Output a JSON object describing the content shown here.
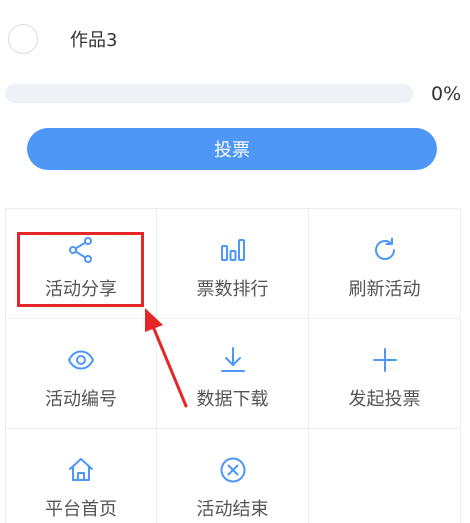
{
  "option": {
    "label": "作品3"
  },
  "progress": {
    "percent": 0,
    "text": "0%"
  },
  "vote_button": {
    "label": "投票"
  },
  "menu": {
    "items": [
      {
        "label": "活动分享",
        "icon": "share-icon"
      },
      {
        "label": "票数排行",
        "icon": "bar-chart-icon"
      },
      {
        "label": "刷新活动",
        "icon": "refresh-icon"
      },
      {
        "label": "活动编号",
        "icon": "eye-icon"
      },
      {
        "label": "数据下载",
        "icon": "download-icon"
      },
      {
        "label": "发起投票",
        "icon": "plus-icon"
      },
      {
        "label": "平台首页",
        "icon": "home-icon"
      },
      {
        "label": "活动结束",
        "icon": "close-circle-icon"
      }
    ]
  },
  "colors": {
    "accent": "#4e97f7",
    "annotation": "#e52626"
  }
}
